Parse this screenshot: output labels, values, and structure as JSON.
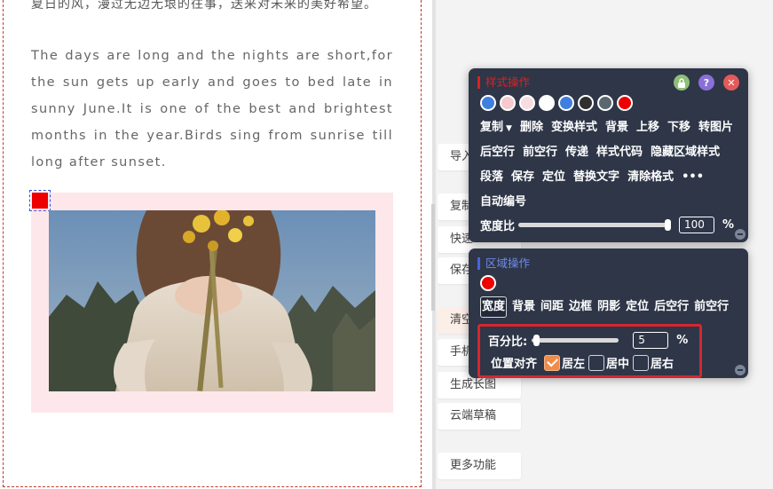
{
  "editor": {
    "top_line": "夏日的风，漫过无边无垠的往事，送来对未来的美好希望。",
    "paragraph": "The days are long and the nights are short,for the sun gets up early and goes to bed late in sunny June.It is one of the best and brightest months in the year.Birds sing from sunrise till long after sunset."
  },
  "side_buttons": [
    "导入",
    "复制",
    "快速",
    "保存",
    "清空",
    "手机",
    "生成长图",
    "云端草稿",
    "更多功能"
  ],
  "style_panel": {
    "title": "样式操作",
    "icons": [
      "lock-icon",
      "help-icon",
      "close-icon"
    ],
    "swatches": [
      "#3f7fe0",
      "#f6c9cf",
      "#f8dde0",
      "#ffffff",
      "#3f7fe0",
      "#2f2f2f",
      "#5b6770",
      "#ee0000"
    ],
    "row1": [
      "复制",
      "删除",
      "变换样式",
      "背景",
      "上移",
      "下移",
      "转图片"
    ],
    "row2": [
      "后空行",
      "前空行",
      "传递",
      "样式代码",
      "隐藏区域样式"
    ],
    "row3": [
      "段落",
      "保存",
      "定位",
      "替换文字",
      "清除格式",
      "•••"
    ],
    "row4": [
      "自动编号"
    ],
    "width_label": "宽度比",
    "width_value": "100",
    "width_unit": "%",
    "width_ratio": 1.0
  },
  "region_panel": {
    "title": "区域操作",
    "swatch": "#ee0000",
    "tabs": [
      "宽度",
      "背景",
      "间距",
      "边框",
      "阴影",
      "定位",
      "后空行",
      "前空行"
    ],
    "percent_label": "百分比:",
    "percent_value": "5",
    "percent_unit": "%",
    "percent_ratio": 0.05,
    "align_label": "位置对齐",
    "align_options": [
      {
        "label": "居左",
        "checked": true
      },
      {
        "label": "居中",
        "checked": false
      },
      {
        "label": "居右",
        "checked": false
      }
    ]
  },
  "colors": {
    "panel_bg": "#2e3648",
    "accent_red": "#e02020",
    "accent_blue": "#6f8be8",
    "highlight": "#d7262e"
  }
}
